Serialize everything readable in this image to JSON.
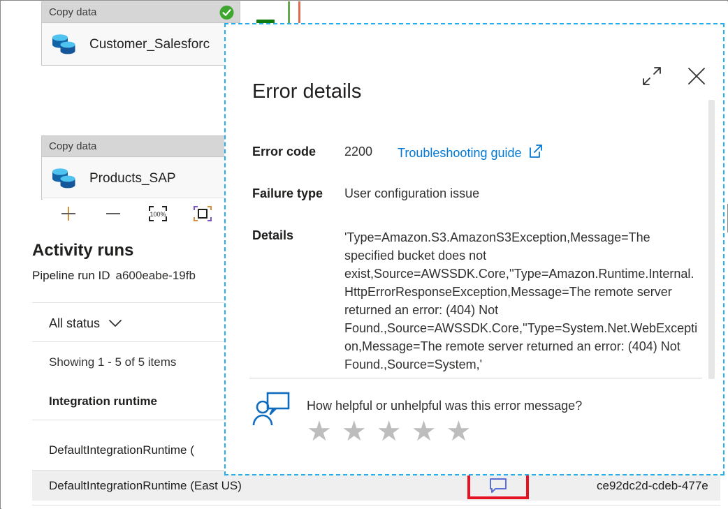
{
  "canvas": {
    "cards": [
      {
        "header": "Copy data",
        "title": "Customer_Salesforc",
        "status_icon": "success-check-icon",
        "db_icon": "database-icon"
      },
      {
        "header": "Copy data",
        "title": "Products_SAP",
        "status_icon": "",
        "db_icon": "database-icon"
      }
    ]
  },
  "zoom_toolbar": {
    "buttons": [
      {
        "name": "zoom-in-button",
        "icon": "plus-icon",
        "label": "+"
      },
      {
        "name": "zoom-out-button",
        "icon": "minus-icon",
        "label": "−"
      },
      {
        "name": "zoom-100-button",
        "icon": "zoom-100-icon",
        "label": "100%"
      },
      {
        "name": "fit-to-screen-button",
        "icon": "fit-screen-icon",
        "label": ""
      }
    ]
  },
  "activity_runs": {
    "title": "Activity runs",
    "pipeline_run_label": "Pipeline run ID",
    "pipeline_run_value": "a600eabe-19fb",
    "status_filter": "All status",
    "status_filter_icon": "chevron-down-icon",
    "showing_count": "Showing 1 - 5 of 5 items",
    "column_header_runtime": "Integration runtime",
    "rows": [
      {
        "runtime": "DefaultIntegrationRuntime (",
        "id": ""
      },
      {
        "runtime": "DefaultIntegrationRuntime (East US)",
        "id": "ce92dc2d-cdeb-477e",
        "comment_icon": "comment-bubble-icon"
      }
    ]
  },
  "error_dialog": {
    "title": "Error details",
    "expand_icon": "expand-diagonal-icon",
    "close_icon": "close-x-icon",
    "error_code_label": "Error code",
    "error_code_value": "2200",
    "troubleshooting_link": "Troubleshooting guide",
    "external_link_icon": "external-link-icon",
    "failure_type_label": "Failure type",
    "failure_type_value": "User configuration issue",
    "details_label": "Details",
    "details_value": "'Type=Amazon.S3.AmazonS3Exception,Message=The specified bucket does not exist,Source=AWSSDK.Core,''Type=Amazon.Runtime.Internal.HttpErrorResponseException,Message=The remote server returned an error: (404) Not Found.,Source=AWSSDK.Core,''Type=System.Net.WebException,Message=The remote server returned an error: (404) Not Found.,Source=System,'",
    "feedback_icon": "person-feedback-icon",
    "feedback_question": "How helpful or unhelpful was this error message?",
    "stars": [
      "★",
      "★",
      "★",
      "★",
      "★"
    ]
  },
  "colors": {
    "accent_blue": "#0078d4",
    "highlight_dashed": "#22b0f0",
    "highlight_red": "#e81123",
    "success_green": "#107c10",
    "star_gray": "#bdbdbd"
  }
}
